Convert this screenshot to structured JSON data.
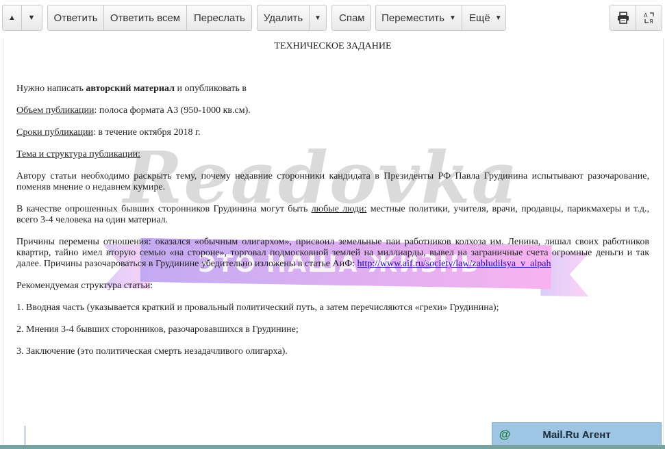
{
  "toolbar": {
    "up_icon": "triangle-up-icon",
    "down_icon": "triangle-down-icon",
    "reply": "Ответить",
    "reply_all": "Ответить всем",
    "forward": "Переслать",
    "delete": "Удалить",
    "spam": "Спам",
    "move": "Переместить",
    "more": "Ещё",
    "print_icon": "printer-icon",
    "translate_icon": "translate-icon"
  },
  "letter": {
    "title": "ТЕХНИЧЕСКОЕ ЗАДАНИЕ",
    "p1_prefix": "Нужно написать ",
    "p1_bold": "авторский материал",
    "p1_suffix": " и опубликовать в",
    "volume_label": "Объем публикации",
    "volume_text": ": полоса формата А3 (950-1000 кв.см).",
    "terms_label": "Сроки публикации",
    "terms_text": ": в течение октября 2018 г.",
    "topic_label": "Тема и структура публикации:",
    "topic_text": "Автору статьи необходимо раскрыть тему, почему недавние сторонники кандидата в Президенты РФ Павла Грудинина испытывают разочарование, поменяв мнение о недавнем кумире.",
    "respondents_prefix": "В качестве опрошенных бывших сторонников Грудинина могут быть ",
    "respondents_underlined": "любые люди:",
    "respondents_suffix": " местные политики, учителя, врачи, продавцы, парикмахеры и т.д., всего 3-4 человека на один материал.",
    "reasons_text": "Причины перемены отношения: оказался «обычным олигархом», присвоил земельные паи работников колхоза им. Ленина, лишал своих работников квартир, тайно имел вторую семью «на стороне», торговал подмосковной землей на миллиарды, вывел на заграничные счета огромные деньги и так далее. Причины разочароваться в Грудинине убедительно изложены в статье АиФ: ",
    "reasons_link": "http://www.aif.ru/society/law/zabludilsya_v_alpah",
    "structure_heading": "Рекомендуемая структура статьи:",
    "item1": "1. Вводная часть (указывается краткий и провальный политический путь, а затем перечисляются «грехи» Грудинина);",
    "item2": "2. Мнения 3-4 бывших сторонников, разочаровавшихся в Грудинине;",
    "item3": "3. Заключение (это политическая смерть незадачливого олигарха)."
  },
  "watermark": {
    "logo": "Readovka",
    "ribbon": "ЭТО НАША ЖИЗНЬ"
  },
  "agent": {
    "icon": "at-sign-icon",
    "label": "Mail.Ru Агент"
  },
  "colors": {
    "link": "#1a0dab",
    "agent_bg": "#9ec5e3",
    "ribbon_left": "#b89cf0",
    "ribbon_right": "#f7a6ee"
  }
}
